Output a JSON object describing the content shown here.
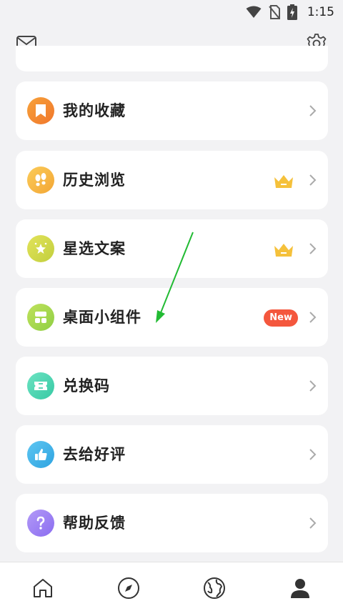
{
  "status_bar": {
    "time": "1:15"
  },
  "menu": {
    "items": [
      {
        "label": "我的收藏",
        "icon": "bookmark-icon",
        "color": "#f5892b"
      },
      {
        "label": "历史浏览",
        "icon": "footprints-icon",
        "color": "#f7b93c",
        "vip": true
      },
      {
        "label": "星选文案",
        "icon": "star-sparkle-icon",
        "color": "#d3d84c",
        "vip": true
      },
      {
        "label": "桌面小组件",
        "icon": "widget-icon",
        "color": "#a8d84f",
        "badge": "New"
      },
      {
        "label": "兑换码",
        "icon": "ticket-icon",
        "color": "#4fd8b2"
      },
      {
        "label": "去给好评",
        "icon": "thumbs-up-icon",
        "color": "#3fb2e9"
      },
      {
        "label": "帮助反馈",
        "icon": "help-icon",
        "color": "#9e82f2"
      }
    ]
  },
  "colors": {
    "background": "#f2f2f4",
    "card": "#ffffff",
    "crown": "#f5c13b",
    "new_badge": "#f4573d",
    "arrow": "#22bb33"
  },
  "bottom_nav": {
    "items": [
      {
        "icon": "home-icon"
      },
      {
        "icon": "compass-icon"
      },
      {
        "icon": "globe-icon"
      },
      {
        "icon": "profile-icon",
        "active": true
      }
    ]
  }
}
